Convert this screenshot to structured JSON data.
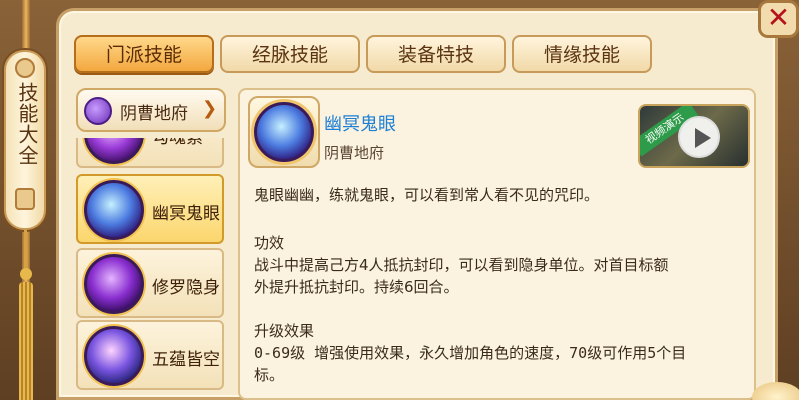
{
  "side_tab": {
    "title": "技能大全"
  },
  "close": {
    "label": "✕"
  },
  "tabs": [
    {
      "label": "门派技能",
      "active": true
    },
    {
      "label": "经脉技能",
      "active": false
    },
    {
      "label": "装备特技",
      "active": false
    },
    {
      "label": "情缘技能",
      "active": false
    }
  ],
  "school_select": {
    "label": "阴曹地府",
    "icon": "ghost-avatar-icon"
  },
  "skills": [
    {
      "name": "勾魂索",
      "icon": "skill-hook-icon",
      "selected": false
    },
    {
      "name": "幽冥鬼眼",
      "icon": "skill-ghost-eye-icon",
      "selected": true
    },
    {
      "name": "修罗隐身",
      "icon": "skill-stealth-icon",
      "selected": false
    },
    {
      "name": "五蕴皆空",
      "icon": "skill-void-icon",
      "selected": false
    }
  ],
  "detail": {
    "title": "幽冥鬼眼",
    "school": "阴曹地府",
    "video_badge": "视频演示",
    "intro": "鬼眼幽幽，练就鬼眼，可以看到常人看不见的咒印。",
    "effect_heading": "功效",
    "effect_line1": "战斗中提高己方4人抵抗封印，可以看到隐身单位。对首目标额",
    "effect_line2": "外提升抵抗封印。持续6回合。",
    "upgrade_heading": "升级效果",
    "upgrade_line1": "0-69级 增强使用效果，永久增加角色的速度，70级可作用5个目",
    "upgrade_line2": "标。"
  },
  "colors": {
    "accent_tab": "#f3a83f",
    "title_blue": "#1d7fd6",
    "close_red": "#b5121b"
  }
}
